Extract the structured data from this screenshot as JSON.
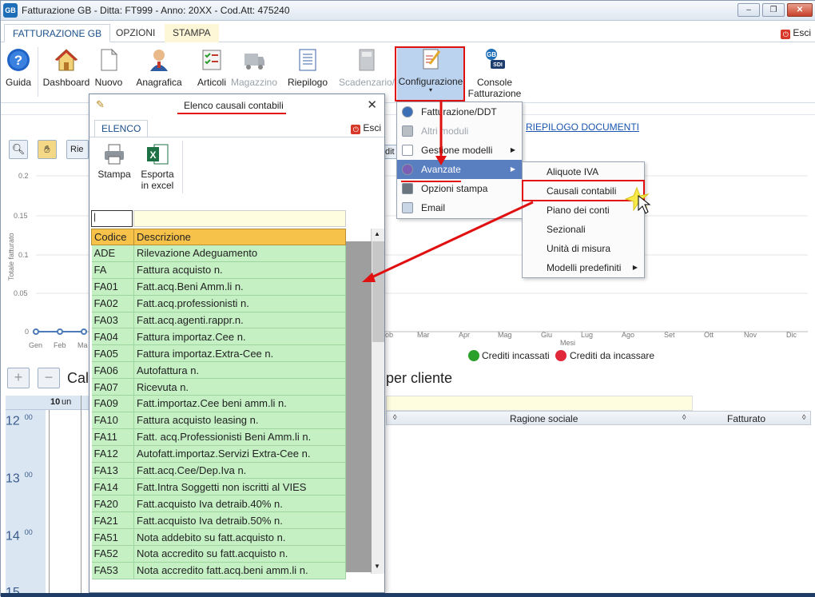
{
  "window": {
    "title": "Fatturazione GB - Ditta: FT999 - Anno: 20XX - Cod.Att: 475240",
    "minimize": "–",
    "restore": "❐",
    "close": "✕"
  },
  "ribbon_tabs": [
    {
      "label": "FATTURAZIONE GB"
    },
    {
      "label": "OPZIONI"
    },
    {
      "label": "STAMPA"
    }
  ],
  "esci_label": "Esci",
  "ribbon_buttons": {
    "guida": "Guida",
    "dashboard": "Dashboard",
    "nuovo": "Nuovo",
    "anagrafica": "Anagrafica",
    "articoli": "Articoli",
    "magazzino": "Magazzino",
    "riepilogo": "Riepilogo",
    "scadenzario": "Scadenzario/",
    "configurazione": "Configurazione",
    "console_line1": "Console",
    "console_line2": "Fatturazione"
  },
  "riepilogo_documenti": "RIEPILOGO DOCUMENTI",
  "chart_bg": {
    "y_ticks": [
      "0.2",
      "0.15",
      "0.1",
      "0.05",
      "0"
    ],
    "y_label": "Totale fatturato",
    "x_ticks": [
      "Gen",
      "Feb",
      "Ma",
      "ob",
      "Mar",
      "Apr",
      "Mag",
      "Giu",
      "Lug",
      "Ago",
      "Set",
      "Ott",
      "Nov",
      "Dic"
    ],
    "x_label": "Mesi",
    "legend": [
      {
        "label": "Crediti incassati",
        "color": "#2aa02a"
      },
      {
        "label": "Crediti da incassare",
        "color": "#e0283a"
      }
    ]
  },
  "left_small_btn": "Rie",
  "cal_partial": "Cal",
  "per_cliente": "per cliente",
  "calendar": {
    "day_label": "10",
    "day_suffix": "un",
    "hours": [
      "12",
      "13",
      "14",
      "15"
    ],
    "minutes": "00"
  },
  "grid_headers": {
    "ragione_sociale": "Ragione sociale",
    "fatturato": "Fatturato"
  },
  "dialog": {
    "title": "Elenco causali contabili",
    "close": "✕",
    "tab": "ELENCO",
    "esci": "Esci",
    "stampa": "Stampa",
    "esporta_line1": "Esporta",
    "esporta_line2": "in excel",
    "filter_value": "|",
    "columns": [
      "Codice",
      "Descrizione"
    ],
    "rows": [
      [
        "ADE",
        "Rilevazione Adeguamento"
      ],
      [
        "FA",
        "Fattura acquisto n."
      ],
      [
        "FA01",
        "Fatt.acq.Beni Amm.li n."
      ],
      [
        "FA02",
        "Fatt.acq.professionisti n."
      ],
      [
        "FA03",
        "Fatt.acq.agenti.rappr.n."
      ],
      [
        "FA04",
        "Fattura importaz.Cee n."
      ],
      [
        "FA05",
        "Fattura importaz.Extra-Cee n."
      ],
      [
        "FA06",
        "Autofattura n."
      ],
      [
        "FA07",
        "Ricevuta n."
      ],
      [
        "FA09",
        "Fatt.importaz.Cee beni amm.li n."
      ],
      [
        "FA10",
        "Fattura acquisto leasing n."
      ],
      [
        "FA11",
        "Fatt. acq.Professionisti Beni Amm.li n."
      ],
      [
        "FA12",
        "Autofatt.importaz.Servizi Extra-Cee n."
      ],
      [
        "FA13",
        "Fatt.acq.Cee/Dep.Iva n."
      ],
      [
        "FA14",
        "Fatt.Intra Soggetti non iscritti al VIES"
      ],
      [
        "FA20",
        "Fatt.acquisto Iva detraib.40% n."
      ],
      [
        "FA21",
        "Fatt.acquisto Iva detraib.50% n."
      ],
      [
        "FA51",
        "Nota addebito su fatt.acquisto n."
      ],
      [
        "FA52",
        "Nota accredito su fatt.acquisto n."
      ],
      [
        "FA53",
        "Nota accredito fatt.acq.beni amm.li n."
      ]
    ]
  },
  "config_menu": [
    {
      "label": "Fatturazione/DDT",
      "disabled": false,
      "submenu": false
    },
    {
      "label": "Altri moduli",
      "disabled": true,
      "submenu": false
    },
    {
      "label": "Gestione modelli",
      "disabled": false,
      "submenu": true
    },
    {
      "label": "Avanzate",
      "disabled": false,
      "submenu": true
    },
    {
      "label": "Opzioni stampa",
      "disabled": false,
      "submenu": false
    },
    {
      "label": "Email",
      "disabled": false,
      "submenu": false
    }
  ],
  "avanzate_menu": [
    {
      "label": "Aliquote IVA"
    },
    {
      "label": "Causali contabili"
    },
    {
      "label": "Piano dei conti"
    },
    {
      "label": "Sezionali"
    },
    {
      "label": "Unità di misura"
    },
    {
      "label": "Modelli predefiniti"
    }
  ]
}
